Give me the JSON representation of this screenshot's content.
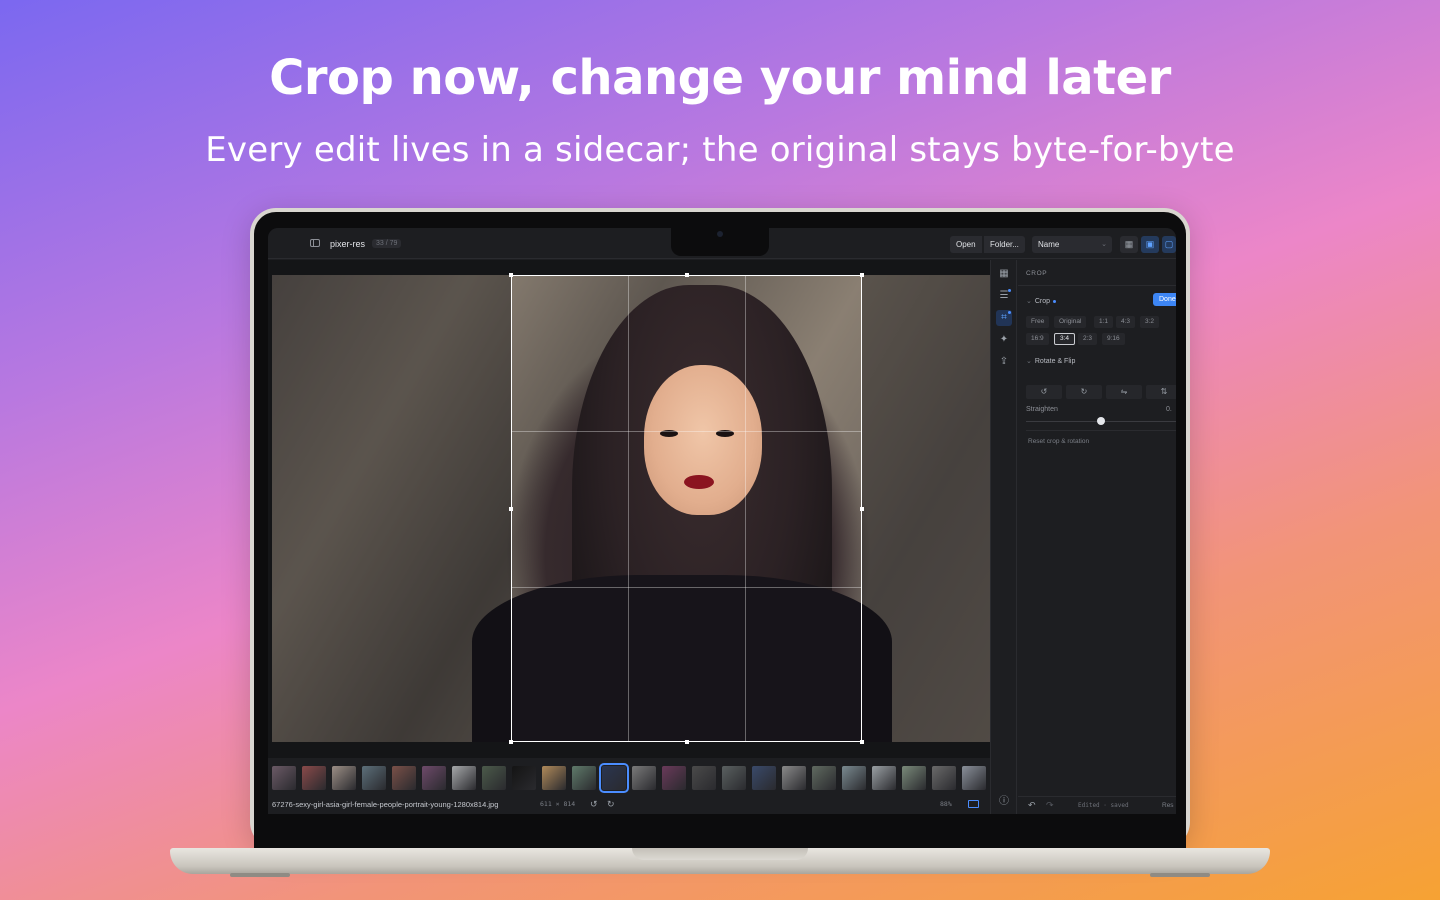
{
  "hero": {
    "title": "Crop now, change your mind later",
    "subtitle": "Every edit lives in a sidecar; the original stays byte-for-byte"
  },
  "app": {
    "title": "pixer-res",
    "count": "33 / 79",
    "open_label": "Open",
    "folder_label": "Folder...",
    "sort_select": "Name"
  },
  "inspector": {
    "header": "CROP",
    "crop_section": "Crop",
    "done_label": "Done",
    "aspect_ratios": [
      "Free",
      "Original",
      "1:1",
      "4:3",
      "3:2",
      "16:9",
      "3:4",
      "2:3",
      "9:16"
    ],
    "selected_ratio": "3:4",
    "rotate_section": "Rotate & Flip",
    "straighten_label": "Straighten",
    "straighten_value": "0.",
    "straighten_level": 0.5,
    "reset_label": "Reset crop & rotation",
    "footer_status": "Edited · saved",
    "footer_reset": "Res"
  },
  "status": {
    "filename": "67276-sexy-girl-asia-girl-female-people-portrait-young-1280x814.jpg",
    "dimensions": "611 × 814",
    "zoom": "88%"
  },
  "icons": {
    "sidebar": "sidebar-toggle-icon",
    "grid_view": "grid-icon",
    "single_view": "image-icon",
    "rotate_left": "↺",
    "rotate_right": "↻",
    "flip_h": "⇋",
    "flip_v": "⇅",
    "undo": "↶",
    "redo": "↷",
    "info": "ⓘ"
  },
  "colors": {
    "accent": "#3d86f5",
    "selected_thumb": "#4b8dff",
    "panel_bg": "#1d1e21"
  }
}
